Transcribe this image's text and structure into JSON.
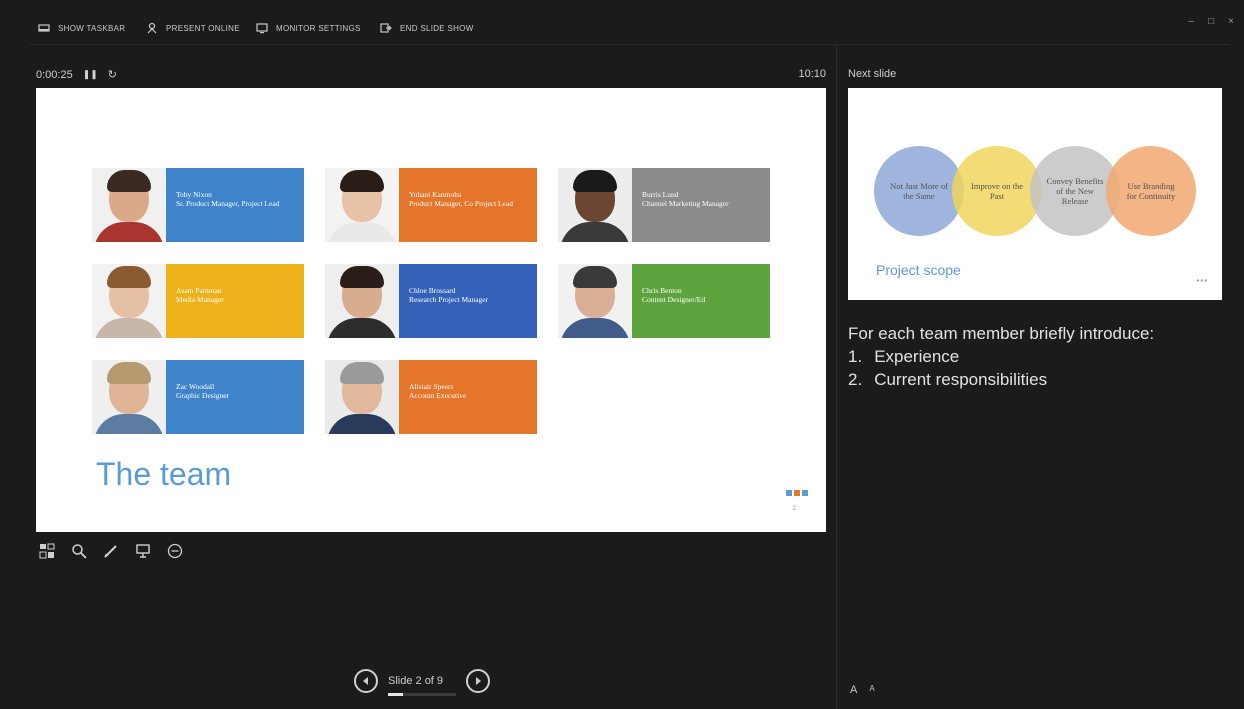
{
  "toolbar": {
    "items": [
      {
        "label": "Show taskbar",
        "icon": "taskbar-icon"
      },
      {
        "label": "Present online",
        "icon": "present-online-icon"
      },
      {
        "label": "Monitor settings",
        "icon": "monitor-icon"
      },
      {
        "label": "End slide show",
        "icon": "end-show-icon"
      }
    ]
  },
  "timer": {
    "elapsed": "0:00:25",
    "clock": "10:10"
  },
  "slide": {
    "title": "The team",
    "number": "2",
    "members": [
      {
        "name": "Toby Nixon",
        "role": "Sr. Product Manager, Project Lead",
        "color": "#3f83cb"
      },
      {
        "name": "Yuhani Kanmoba",
        "role": "Product Manager, Co Project Lead",
        "color": "#e4752a"
      },
      {
        "name": "Burris Lund",
        "role": "Channel Marketing Manager",
        "color": "#8b8b8b"
      },
      {
        "name": "Asam Pamman",
        "role": "Media Manager",
        "color": "#edb21a"
      },
      {
        "name": "Chloe Brossard",
        "role": "Research Project Manager",
        "color": "#3462b8"
      },
      {
        "name": "Chris Benton",
        "role": "Content Designer/Ed",
        "color": "#5ea43e"
      },
      {
        "name": "Zac Woodall",
        "role": "Graphic Designer",
        "color": "#3f83cb"
      },
      {
        "name": "Alistair Speers",
        "role": "Account Executive",
        "color": "#e4752a"
      }
    ]
  },
  "next_slide": {
    "label": "Next slide",
    "title": "Project scope",
    "circles": [
      {
        "text": "Not Just More of the Same",
        "color": "#8fa9d8"
      },
      {
        "text": "Improve on the Past",
        "color": "#f2d55e"
      },
      {
        "text": "Convey Benefits of the New Release",
        "color": "#c4c4c4"
      },
      {
        "text": "Use Branding for Continuity",
        "color": "#f2a872"
      }
    ],
    "dots": "▪▪▪"
  },
  "notes": {
    "intro": "For each team member briefly introduce:",
    "items": [
      {
        "num": "1.",
        "text": "Experience"
      },
      {
        "num": "2.",
        "text": "Current responsibilities"
      }
    ]
  },
  "navigation": {
    "counter": "Slide 2 of 9",
    "progress": 0.222
  },
  "font_controls": [
    "A",
    "A"
  ],
  "colors": {
    "background": "#1b1b1b",
    "accent_title": "#5b9bd5"
  }
}
